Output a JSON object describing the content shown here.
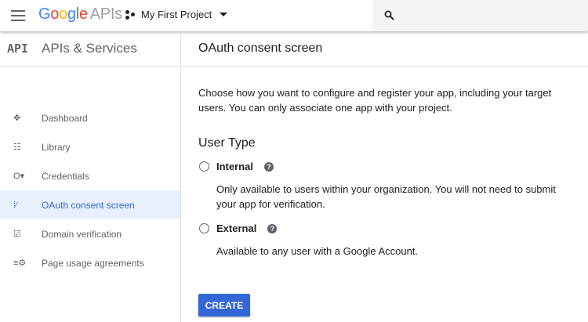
{
  "topbar": {
    "logo_google": "Google",
    "logo_apis": "APIs",
    "project": "My First Project"
  },
  "sidebar": {
    "badge": "API",
    "title": "APIs & Services",
    "items": [
      {
        "label": "Dashboard",
        "icon": "dashboard-icon",
        "glyph": "✥"
      },
      {
        "label": "Library",
        "icon": "library-icon",
        "glyph": "☷"
      },
      {
        "label": "Credentials",
        "icon": "key-icon",
        "glyph": "O▾"
      },
      {
        "label": "OAuth consent screen",
        "icon": "consent-icon",
        "glyph": "⁞⁄",
        "selected": true
      },
      {
        "label": "Domain verification",
        "icon": "domain-check-icon",
        "glyph": "☑"
      },
      {
        "label": "Page usage agreements",
        "icon": "settings-list-icon",
        "glyph": "≡⚙"
      }
    ]
  },
  "main": {
    "title": "OAuth consent screen",
    "intro": "Choose how you want to configure and register your app, including your target users. You can only associate one app with your project.",
    "user_type": "User Type",
    "options": [
      {
        "label": "Internal",
        "desc": "Only available to users within your organization. You will not need to submit your app for verification."
      },
      {
        "label": "External",
        "desc": "Available to any user with a Google Account."
      }
    ],
    "create": "CREATE"
  },
  "colors": {
    "accent": "#3367d6",
    "selected_bg": "#e8f0fe"
  }
}
